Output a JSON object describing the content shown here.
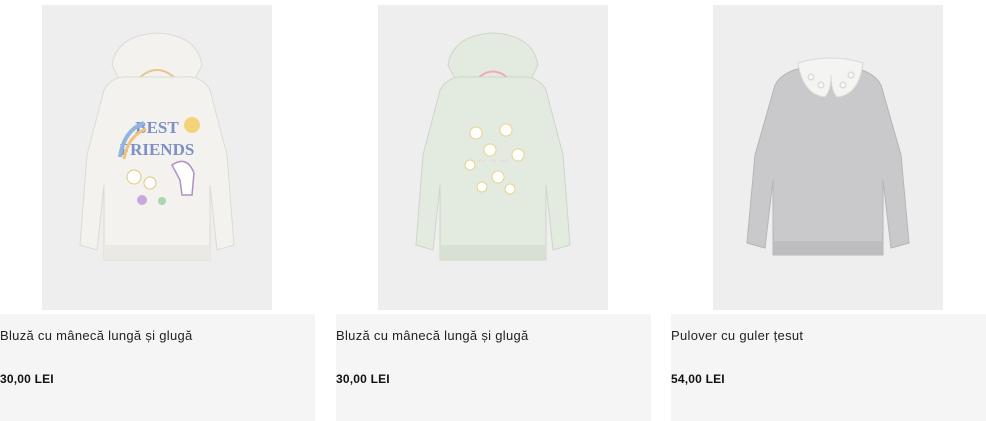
{
  "products": [
    {
      "title": "Bluză cu mânecă lungă și glugă",
      "price": "30,00 LEI",
      "image_icon": "white-hoodie-best-friends-image",
      "print_text_1": "BEST",
      "print_text_2": "FRIENDS",
      "colors": {
        "garment": "#f3f2ee",
        "print": "#7e8fc8"
      }
    },
    {
      "title": "Bluză cu mânecă lungă și glugă",
      "price": "30,00 LEI",
      "image_icon": "mint-hoodie-flowers-image",
      "colors": {
        "garment": "#e3eadf",
        "print": "#f4c6d4"
      }
    },
    {
      "title": "Pulover cu guler țesut",
      "price": "54,00 LEI",
      "image_icon": "grey-sweater-lace-collar-image",
      "colors": {
        "garment": "#c9c9cb",
        "print": "#f4f4f2"
      }
    }
  ]
}
